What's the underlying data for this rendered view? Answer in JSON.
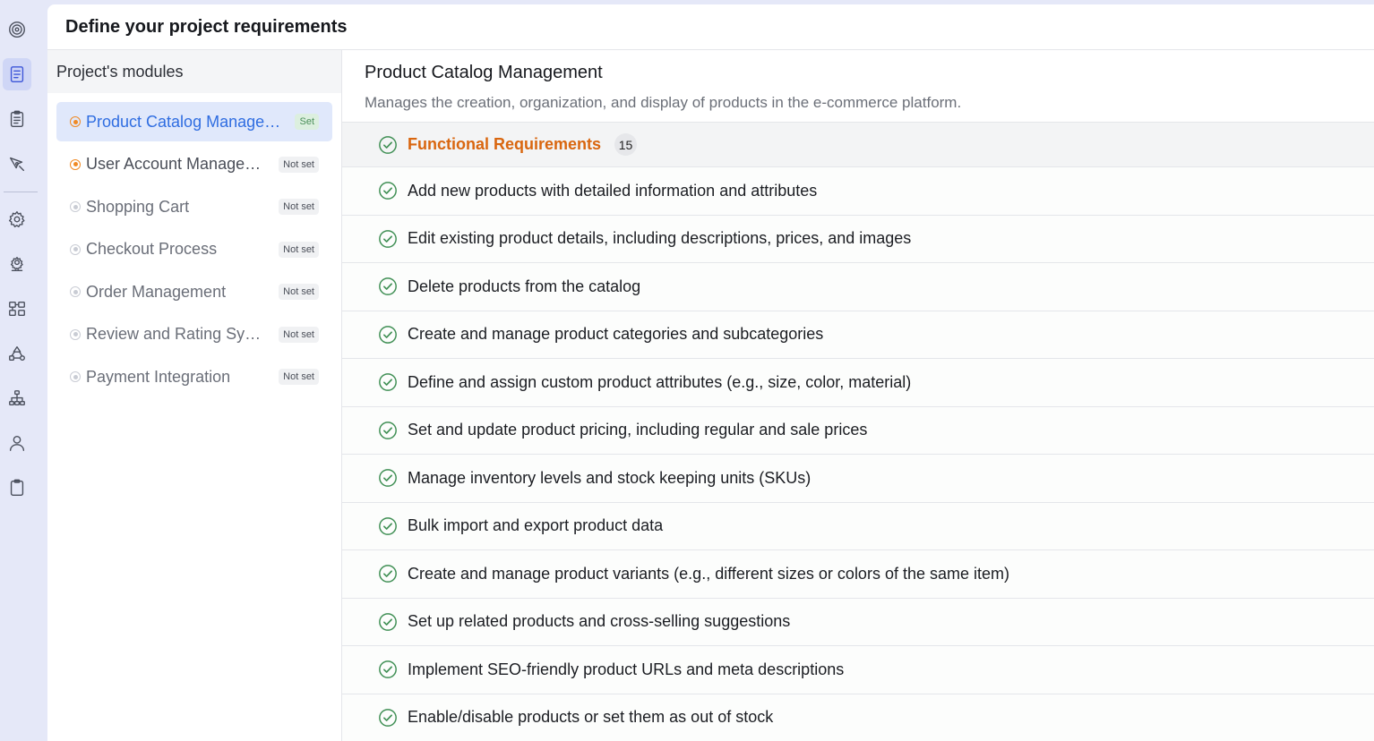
{
  "rail": {
    "icons": [
      "target-icon",
      "document-icon",
      "clipboard-list-icon",
      "pen-tool-icon",
      "settings-icon",
      "network-gear-icon",
      "grid-modules-icon",
      "flow-shapes-icon",
      "hierarchy-icon",
      "user-icon",
      "clipboard-icon"
    ],
    "active": "document-icon"
  },
  "header": {
    "title": "Define your project requirements"
  },
  "modules": {
    "heading": "Project's modules",
    "items": [
      {
        "label": "Product Catalog Management",
        "status": "Set",
        "state": "active"
      },
      {
        "label": "User Account Management",
        "status": "Not set",
        "state": "started"
      },
      {
        "label": "Shopping Cart",
        "status": "Not set",
        "state": "idle"
      },
      {
        "label": "Checkout Process",
        "status": "Not set",
        "state": "idle"
      },
      {
        "label": "Order Management",
        "status": "Not set",
        "state": "idle"
      },
      {
        "label": "Review and Rating System",
        "status": "Not set",
        "state": "idle"
      },
      {
        "label": "Payment Integration",
        "status": "Not set",
        "state": "idle"
      }
    ]
  },
  "content": {
    "title": "Product Catalog Management",
    "description": "Manages the creation, organization, and display of products in the e-commerce platform.",
    "section": {
      "title": "Functional Requirements",
      "count": "15"
    },
    "requirements": [
      "Add new products with detailed information and attributes",
      "Edit existing product details, including descriptions, prices, and images",
      "Delete products from the catalog",
      "Create and manage product categories and subcategories",
      "Define and assign custom product attributes (e.g., size, color, material)",
      "Set and update product pricing, including regular and sale prices",
      "Manage inventory levels and stock keeping units (SKUs)",
      "Bulk import and export product data",
      "Create and manage product variants (e.g., different sizes or colors of the same item)",
      "Set up related products and cross-selling suggestions",
      "Implement SEO-friendly product URLs and meta descriptions",
      "Enable/disable products or set them as out of stock"
    ]
  },
  "colors": {
    "accent": "#2f6de1",
    "orange": "#d9660f",
    "check": "#3f8f54"
  }
}
